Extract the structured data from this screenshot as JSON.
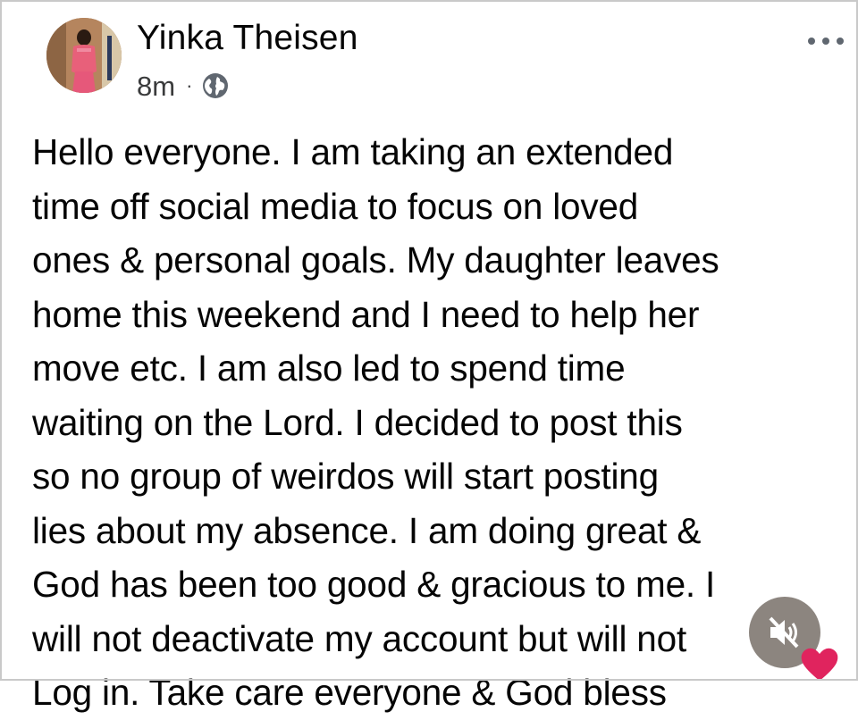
{
  "post": {
    "author": "Yinka Theisen",
    "time": "8m",
    "separator": "·",
    "privacy_icon": "globe-icon",
    "more_icon": "more-horizontal-icon",
    "body_lines": [
      "Hello everyone. I am taking an extended",
      "time off social media to focus on loved",
      "ones & personal goals. My daughter leaves",
      "home this weekend and I need to help her",
      "move etc. I am also led to spend time",
      "waiting on the Lord. I decided to post this",
      "so no group of weirdos will start posting",
      "lies about my absence. I am doing great &",
      "God has been too good & gracious to me. I",
      "will not deactivate my account but will not",
      "Log in. Take care everyone & God bless"
    ],
    "trailing_emoji_icon": "red-heart-icon"
  },
  "overlay": {
    "mute_icon": "speaker-muted-icon"
  },
  "colors": {
    "text": "#050505",
    "meta": "#3a3b3c",
    "heart": "#e0245e",
    "mute_bg": "#787068"
  }
}
